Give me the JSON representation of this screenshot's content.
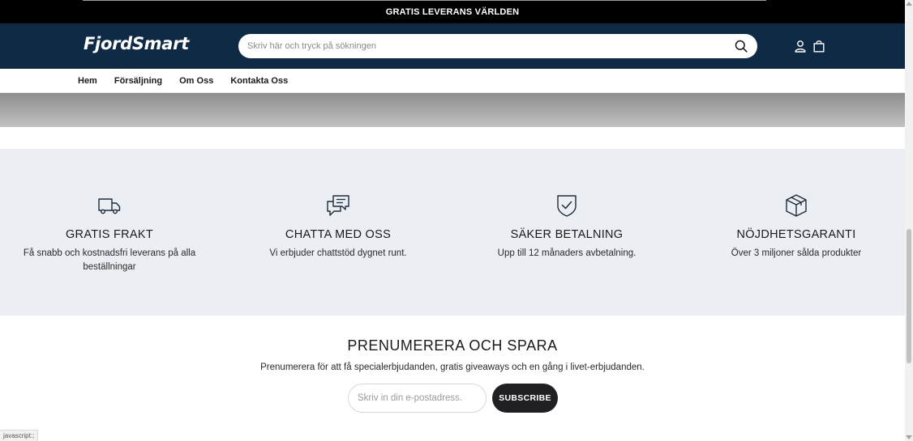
{
  "announcement": {
    "text": "GRATIS LEVERANS VÄRLDEN"
  },
  "header": {
    "logo": "FjordSmart",
    "search_placeholder": "Skriv här och tryck på sökningen",
    "icons": [
      "search-icon",
      "account-icon",
      "cart-icon"
    ]
  },
  "nav": {
    "items": [
      "Hem",
      "Försäljning",
      "Om Oss",
      "Kontakta Oss"
    ]
  },
  "features": [
    {
      "icon": "truck-icon",
      "title": "GRATIS FRAKT",
      "text": "Få snabb och kostnadsfri leverans på alla beställningar"
    },
    {
      "icon": "chat-icon",
      "title": "CHATTA MED OSS",
      "text": "Vi erbjuder chattstöd dygnet runt."
    },
    {
      "icon": "shield-check-icon",
      "title": "SÄKER BETALNING",
      "text": "Upp till 12 månaders avbetalning."
    },
    {
      "icon": "box-icon",
      "title": "NÖJDHETSGARANTI",
      "text": "Över 3 miljoner sålda produkter"
    }
  ],
  "subscribe": {
    "title": "PRENUMERERA OCH SPARA",
    "text": "Prenumerera för att få specialerbjudanden, gratis giveaways och en gång i livet-erbjudanden.",
    "email_placeholder": "Skriv in din e-postadress.",
    "button_label": "SUBSCRIBE"
  },
  "status_bar": {
    "text": "javascript:;"
  },
  "colors": {
    "header_bg": "#0f2a44",
    "features_bg": "#ebeef2",
    "button_bg": "#1f1f24"
  }
}
